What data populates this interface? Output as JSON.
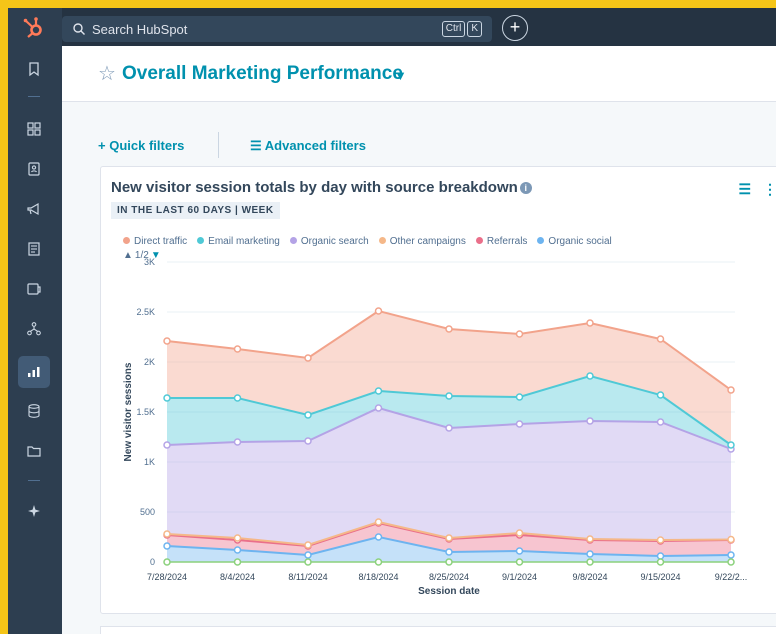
{
  "topbar": {
    "search_placeholder": "Search HubSpot",
    "shortcut_keys": [
      "Ctrl",
      "K"
    ],
    "create_label": "+"
  },
  "sidebar": {
    "icons": [
      "bookmark-icon",
      "apps-grid-icon",
      "contacts-icon",
      "megaphone-icon",
      "content-icon",
      "commerce-icon",
      "automation-icon",
      "reports-icon",
      "data-icon",
      "library-icon",
      "breeze-icon"
    ]
  },
  "dashboard": {
    "title": "Overall Marketing Performance",
    "quick_filters_label": "Quick filters",
    "advanced_filters_label": "Advanced filters"
  },
  "report": {
    "title": "New visitor session totals by day with source breakdown",
    "range_badge": "IN THE LAST 60 DAYS | WEEK",
    "pager": "1/2"
  },
  "colors": {
    "accent": "#0091ae",
    "direct": "#f2a38b",
    "email": "#4fc9d6",
    "organic_search": "#b4a3e6",
    "other": "#f5b889",
    "referrals": "#ea6f8a",
    "organic_social": "#6db4f0",
    "bottom_series": "#8bd17c"
  },
  "chart_data": {
    "type": "area",
    "xlabel": "Session date",
    "ylabel": "New visitor sessions",
    "ylim": [
      0,
      3000
    ],
    "yticks": [
      "0",
      "500",
      "1K",
      "1.5K",
      "2K",
      "2.5K",
      "3K"
    ],
    "categories": [
      "7/28/2024",
      "8/4/2024",
      "8/11/2024",
      "8/18/2024",
      "8/25/2024",
      "9/1/2024",
      "9/8/2024",
      "9/15/2024",
      "9/22/2..."
    ],
    "legend": [
      "Direct traffic",
      "Email marketing",
      "Organic search",
      "Other campaigns",
      "Referrals",
      "Organic social"
    ],
    "cumulative_series": [
      {
        "name": "Organic social",
        "values": [
          160,
          120,
          70,
          250,
          100,
          110,
          80,
          60,
          70
        ]
      },
      {
        "name": "Referrals",
        "values": [
          270,
          220,
          160,
          390,
          230,
          270,
          220,
          210,
          220
        ]
      },
      {
        "name": "Other campaigns",
        "values": [
          280,
          240,
          170,
          400,
          240,
          290,
          230,
          220,
          225
        ]
      },
      {
        "name": "Organic search",
        "values": [
          1170,
          1200,
          1210,
          1540,
          1340,
          1380,
          1410,
          1400,
          1130
        ]
      },
      {
        "name": "Email marketing",
        "values": [
          1640,
          1640,
          1470,
          1710,
          1660,
          1650,
          1860,
          1670,
          1170
        ]
      },
      {
        "name": "Direct traffic",
        "values": [
          2210,
          2130,
          2040,
          2510,
          2330,
          2280,
          2390,
          2230,
          1720
        ]
      }
    ],
    "base_series": {
      "values": [
        0,
        0,
        0,
        0,
        0,
        0,
        0,
        0,
        0
      ]
    }
  }
}
